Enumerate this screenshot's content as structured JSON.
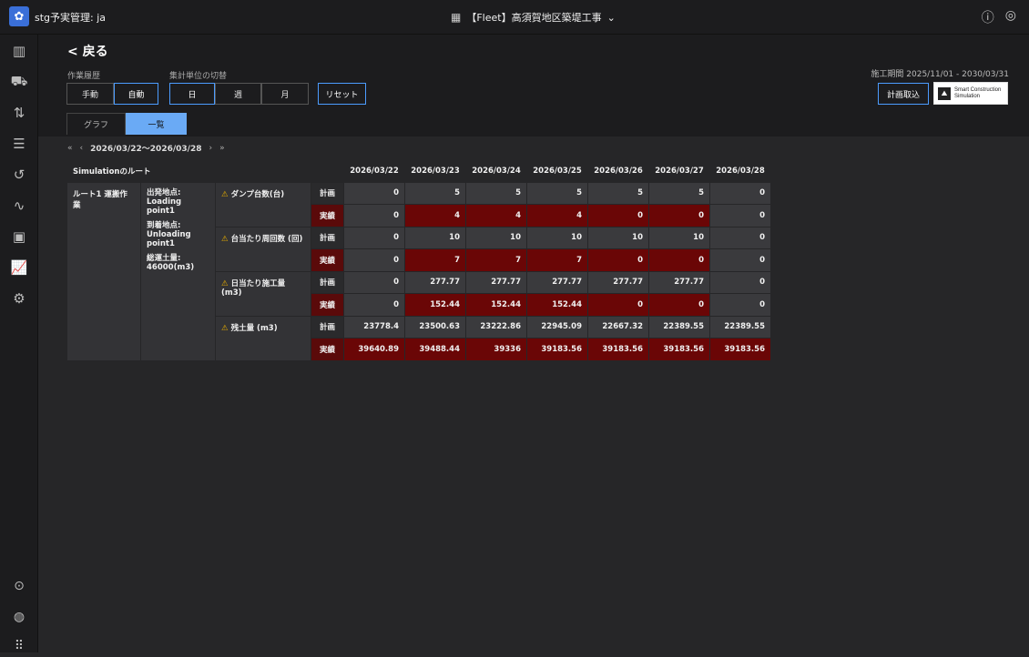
{
  "app": {
    "name": "stg予実管理: ja",
    "project": "【Fleet】高須賀地区築堤工事"
  },
  "nav": {
    "back": "< 戻る"
  },
  "filters": {
    "work_history_label": "作業履歴",
    "work_history_options": [
      "手動",
      "自動"
    ],
    "aggregation_label": "集計単位の切替",
    "aggregation_options": [
      "日",
      "週",
      "月"
    ],
    "reset": "リセット"
  },
  "period": "施工期間 2025/11/01 - 2030/03/31",
  "plan_button": "計画取込",
  "brand": {
    "line1": "Smart Construction",
    "line2": "Simulation"
  },
  "tabs": [
    "グラフ",
    "一覧"
  ],
  "date_range": "2026/03/22～2026/03/28",
  "table": {
    "route_header": "Simulationのルート",
    "dates": [
      "2026/03/22",
      "2026/03/23",
      "2026/03/24",
      "2026/03/25",
      "2026/03/26",
      "2026/03/27",
      "2026/03/28"
    ],
    "route_name": "ルート1 運搬作業",
    "info": {
      "origin_label": "出発地点:",
      "origin": "Loading point1",
      "dest_label": "到着地点:",
      "dest": "Unloading point1",
      "total_label": "総運土量:",
      "total": "46000(m3)"
    },
    "plan_label": "計画",
    "actual_label": "実績",
    "metrics": [
      {
        "name": "ダンプ台数(台)",
        "plan": [
          "0",
          "5",
          "5",
          "5",
          "5",
          "5",
          "0"
        ],
        "actual": [
          "0",
          "4",
          "4",
          "4",
          "0",
          "0",
          "0"
        ]
      },
      {
        "name": "台当たり周回数 (回)",
        "plan": [
          "0",
          "10",
          "10",
          "10",
          "10",
          "10",
          "0"
        ],
        "actual": [
          "0",
          "7",
          "7",
          "7",
          "0",
          "0",
          "0"
        ]
      },
      {
        "name": "日当たり施工量 (m3)",
        "plan": [
          "0",
          "277.77",
          "277.77",
          "277.77",
          "277.77",
          "277.77",
          "0"
        ],
        "actual": [
          "0",
          "152.44",
          "152.44",
          "152.44",
          "0",
          "0",
          "0"
        ]
      },
      {
        "name": "残土量 (m3)",
        "plan": [
          "23778.4",
          "23500.63",
          "23222.86",
          "22945.09",
          "22667.32",
          "22389.55",
          "22389.55"
        ],
        "actual": [
          "39640.89",
          "39488.44",
          "39336",
          "39183.56",
          "39183.56",
          "39183.56",
          "39183.56"
        ]
      }
    ]
  }
}
